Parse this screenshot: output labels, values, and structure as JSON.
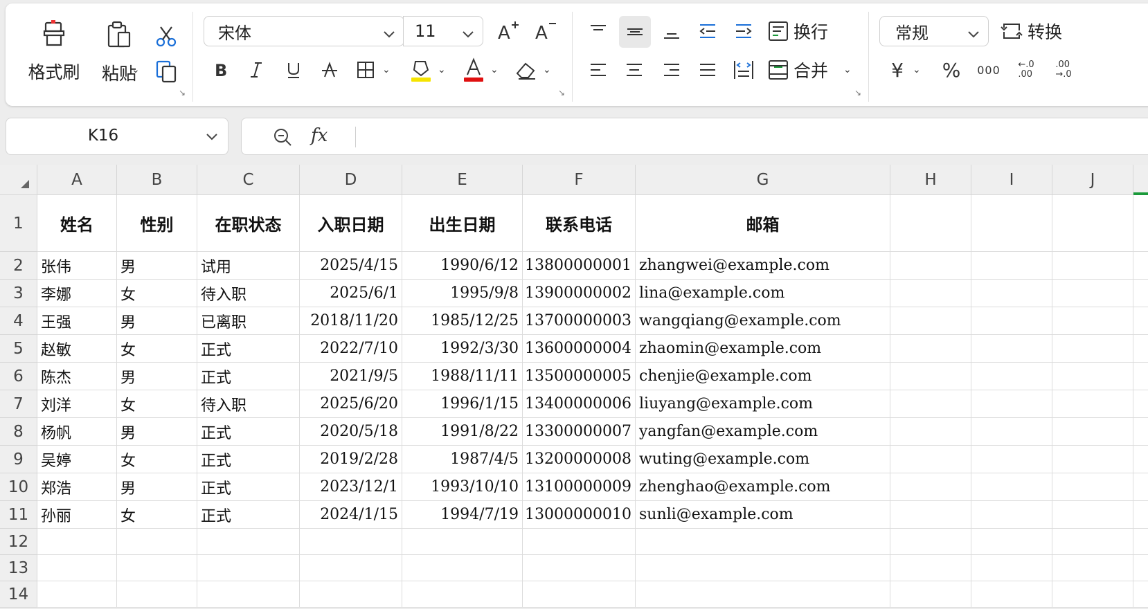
{
  "ribbon": {
    "clipboard": {
      "format_painter": "格式刷",
      "paste": "粘贴"
    },
    "font": {
      "name": "宋体",
      "size": "11"
    },
    "alignment": {
      "wrap": "换行",
      "merge": "合并"
    },
    "number": {
      "format": "常规",
      "convert": "转换",
      "currency_symbol": "¥",
      "percent_symbol": "%",
      "thousands_symbol": "000",
      "increase_decimal": "←.0\n.00",
      "decrease_decimal": ".00\n→.0"
    },
    "colors": {
      "highlight": "#f5e400",
      "font_color": "#e01010"
    }
  },
  "formula_bar": {
    "cell_ref": "K16",
    "fx": "fx",
    "content": ""
  },
  "sheet": {
    "columns": [
      "A",
      "B",
      "C",
      "D",
      "E",
      "F",
      "G",
      "H",
      "I",
      "J"
    ],
    "row_numbers": [
      "1",
      "2",
      "3",
      "4",
      "5",
      "6",
      "7",
      "8",
      "9",
      "10",
      "11",
      "12",
      "13",
      "14"
    ],
    "header": [
      "姓名",
      "性别",
      "在职状态",
      "入职日期",
      "出生日期",
      "联系电话",
      "邮箱"
    ],
    "rows": [
      [
        "张伟",
        "男",
        "试用",
        "2025/4/15",
        "1990/6/12",
        "13800000001",
        "zhangwei@example.com"
      ],
      [
        "李娜",
        "女",
        "待入职",
        "2025/6/1",
        "1995/9/8",
        "13900000002",
        "lina@example.com"
      ],
      [
        "王强",
        "男",
        "已离职",
        "2018/11/20",
        "1985/12/25",
        "13700000003",
        "wangqiang@example.com"
      ],
      [
        "赵敏",
        "女",
        "正式",
        "2022/7/10",
        "1992/3/30",
        "13600000004",
        "zhaomin@example.com"
      ],
      [
        "陈杰",
        "男",
        "正式",
        "2021/9/5",
        "1988/11/11",
        "13500000005",
        "chenjie@example.com"
      ],
      [
        "刘洋",
        "女",
        "待入职",
        "2025/6/20",
        "1996/1/15",
        "13400000006",
        "liuyang@example.com"
      ],
      [
        "杨帆",
        "男",
        "正式",
        "2020/5/18",
        "1991/8/22",
        "13300000007",
        "yangfan@example.com"
      ],
      [
        "吴婷",
        "女",
        "正式",
        "2019/2/28",
        "1987/4/5",
        "13200000008",
        "wuting@example.com"
      ],
      [
        "郑浩",
        "男",
        "正式",
        "2023/12/1",
        "1993/10/10",
        "13100000009",
        "zhenghao@example.com"
      ],
      [
        "孙丽",
        "女",
        "正式",
        "2024/1/15",
        "1994/7/19",
        "13000000010",
        "sunli@example.com"
      ]
    ]
  }
}
